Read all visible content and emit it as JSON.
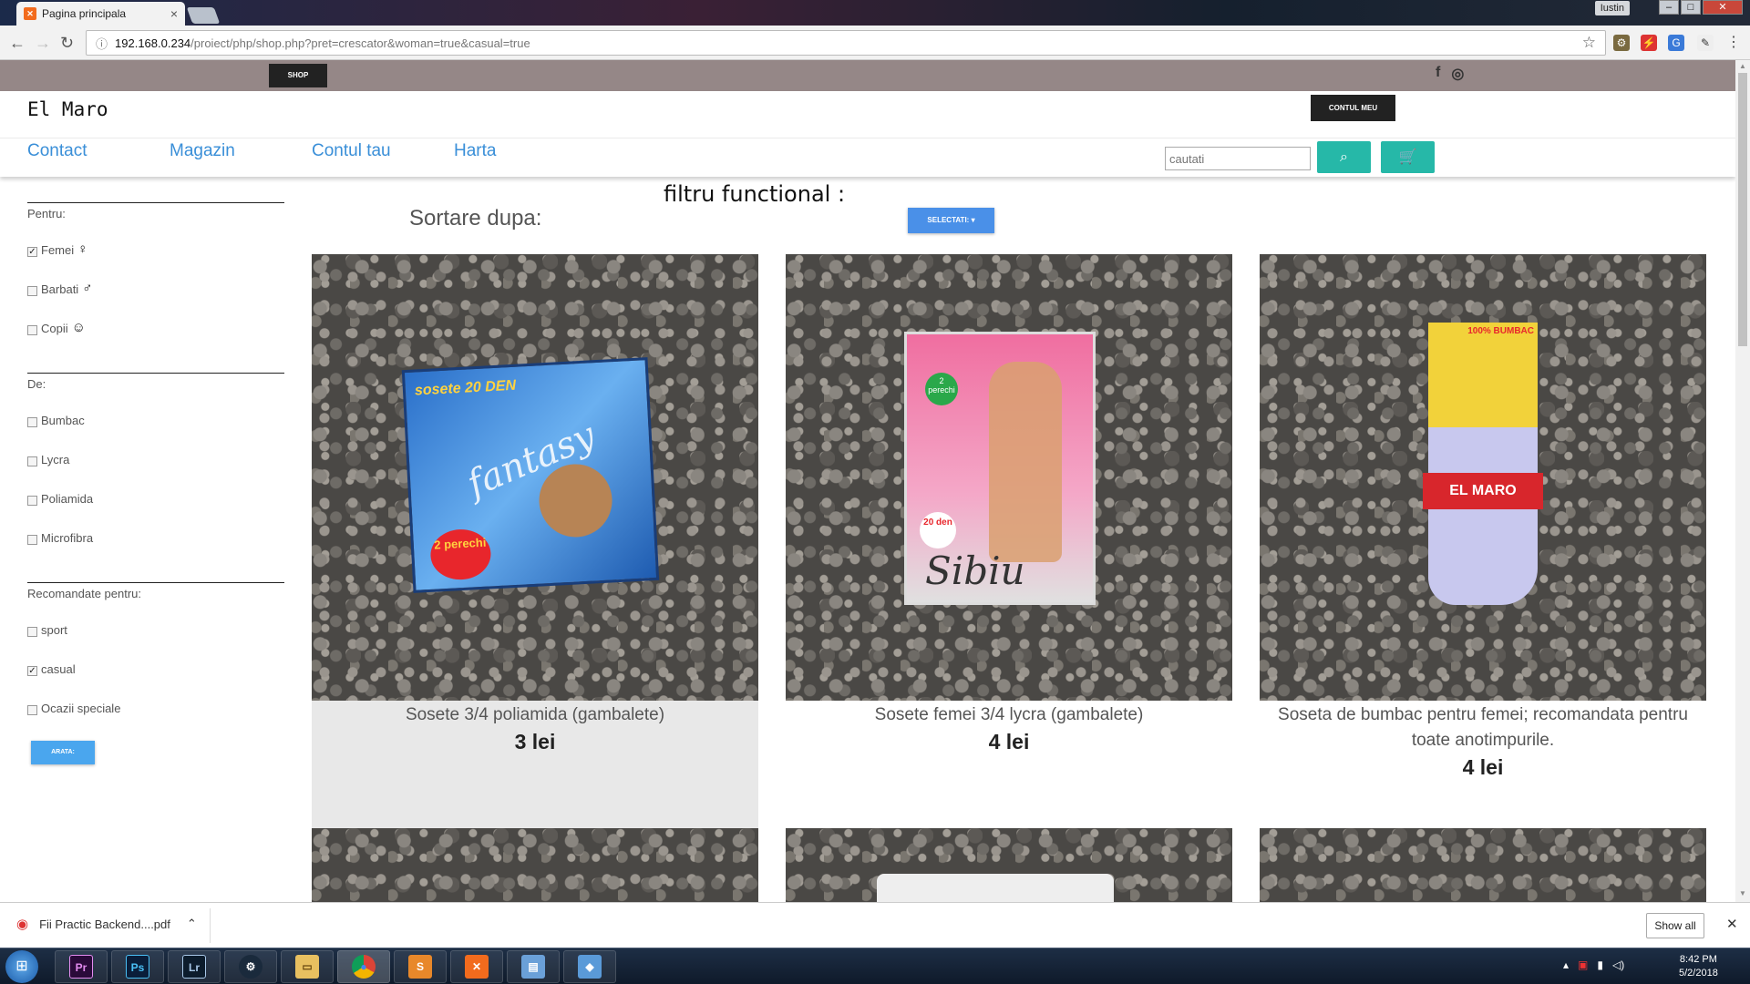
{
  "browser": {
    "tab_title": "Pagina principala",
    "tab_close": "×",
    "user_badge": "Iustin",
    "url_host": "192.168.0.234",
    "url_path": "/proiect/php/shop.php?pret=crescator&woman=true&casual=true"
  },
  "site": {
    "shop_button": "SHOP",
    "brand": "El Maro",
    "account_button": "CONTUL MEU",
    "nav": [
      "Contact",
      "Magazin",
      "Contul tau",
      "Harta"
    ],
    "search_placeholder": "cautati"
  },
  "filters": {
    "sections": [
      {
        "title": "Pentru:",
        "options": [
          {
            "label": "Femei",
            "checked": true,
            "icon": "woman-icon"
          },
          {
            "label": "Barbati",
            "checked": false,
            "icon": "man-icon"
          },
          {
            "label": "Copii",
            "checked": false,
            "icon": "child-icon"
          }
        ]
      },
      {
        "title": "De:",
        "options": [
          {
            "label": "Bumbac",
            "checked": false
          },
          {
            "label": "Lycra",
            "checked": false
          },
          {
            "label": "Poliamida",
            "checked": false
          },
          {
            "label": "Microfibra",
            "checked": false
          }
        ]
      },
      {
        "title": "Recomandate pentru:",
        "options": [
          {
            "label": "sport",
            "checked": false
          },
          {
            "label": "casual",
            "checked": true
          },
          {
            "label": "Ocazii speciale",
            "checked": false
          }
        ]
      }
    ],
    "apply_button": "ARATA:"
  },
  "main": {
    "filter_title": "filtru functional :",
    "sort_label": "Sortare dupa:",
    "select_button": "SELECTATI:",
    "products": [
      {
        "name": "Sosete 3/4 poliamida (gambalete)",
        "price": "3 lei",
        "pkg_text": "sosete 20 DEN",
        "pkg_brand": "fantasy",
        "pkg_badge": "2 perechi"
      },
      {
        "name": "Sosete femei 3/4 lycra (gambalete)",
        "price": "4 lei",
        "pkg_text": "20 den",
        "pkg_brand": "Sibiu",
        "pkg_badge": "2 perechi"
      },
      {
        "name": "Soseta de bumbac pentru femei; recomandata pentru toate anotimpurile.",
        "price": "4 lei",
        "pkg_text": "100% BUMBAC",
        "pkg_brand": "EL MARO",
        "pkg_badge": ""
      }
    ]
  },
  "downloads": {
    "file": "Fii Practic Backend....pdf",
    "show_all": "Show all"
  },
  "taskbar": {
    "time": "8:42 PM",
    "date": "5/2/2018"
  },
  "colors": {
    "accent_teal": "#26b8a8",
    "link_blue": "#3a8fd8",
    "top_strip": "#958787"
  }
}
